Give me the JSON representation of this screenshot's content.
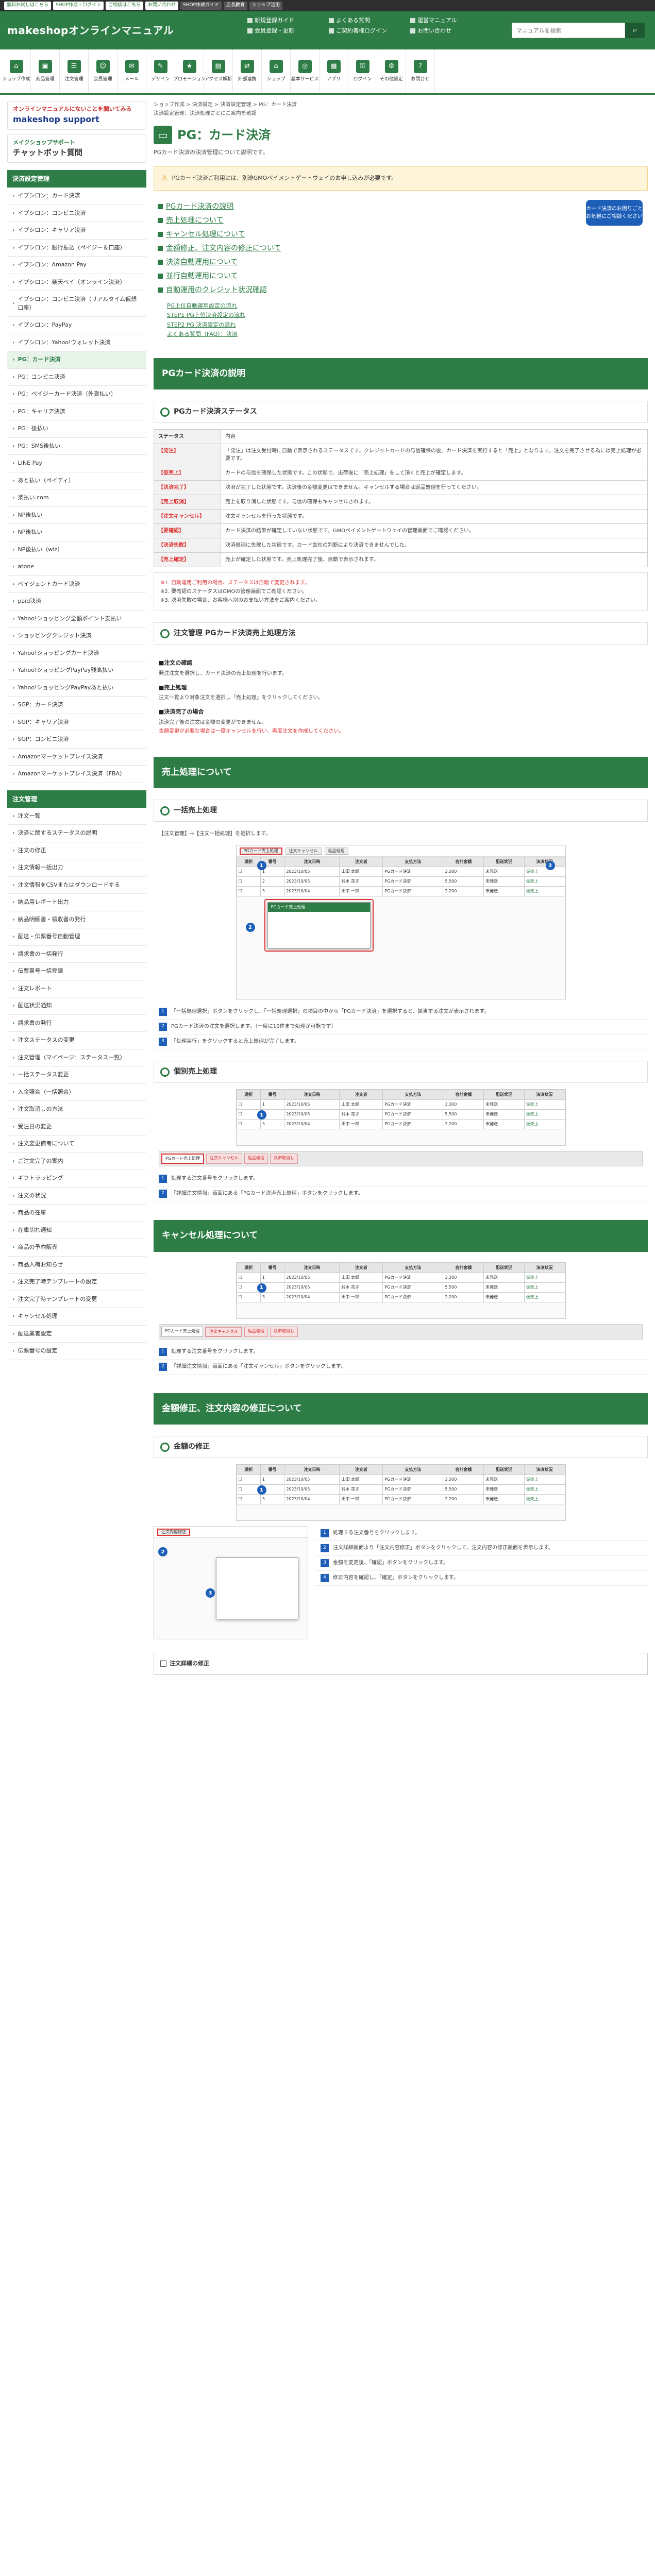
{
  "topbar": {
    "buttons": [
      "無料お試しはこちら",
      "SHOP作成・ログイン",
      "ご相談はこちら",
      "お問い合わせ",
      "SHOP作成ガイド",
      "店長教育",
      "ショップ活用"
    ]
  },
  "header": {
    "logo": "makeshopオンラインマニュアル",
    "links": [
      "新規登録ガイド",
      "よくある質問",
      "運営マニュアル",
      "会員登録・更新",
      "ご契約者様ログイン",
      "お問い合わせ"
    ],
    "search_placeholder": "マニュアルを検索"
  },
  "nav": [
    {
      "label": "ショップ作成",
      "icon": "shop-icon",
      "glyph": "⌂"
    },
    {
      "label": "商品管理",
      "icon": "box-icon",
      "glyph": "▣"
    },
    {
      "label": "注文管理",
      "icon": "order-icon",
      "glyph": "☰"
    },
    {
      "label": "会員管理",
      "icon": "user-icon",
      "glyph": "☺"
    },
    {
      "label": "メール",
      "icon": "mail-icon",
      "glyph": "✉"
    },
    {
      "label": "デザイン",
      "icon": "design-icon",
      "glyph": "✎"
    },
    {
      "label": "プロモーション",
      "icon": "promo-icon",
      "glyph": "★"
    },
    {
      "label": "アクセス解析",
      "icon": "chart-icon",
      "glyph": "▤"
    },
    {
      "label": "外部連携",
      "icon": "link-icon",
      "glyph": "⇄"
    },
    {
      "label": "ショップ",
      "icon": "store-icon",
      "glyph": "⌂"
    },
    {
      "label": "基本サービス",
      "icon": "service-icon",
      "glyph": "◎"
    },
    {
      "label": "アプリ",
      "icon": "app-icon",
      "glyph": "▦"
    },
    {
      "label": "ログイン",
      "icon": "login-icon",
      "glyph": "⚿"
    },
    {
      "label": "その他設定",
      "icon": "settings-icon",
      "glyph": "⚙"
    },
    {
      "label": "お問合せ",
      "icon": "contact-icon",
      "glyph": "?"
    }
  ],
  "sidebar": {
    "banner1": {
      "top": "オンラインマニュアルにないことを聞いてみる",
      "brand": "makeshop support"
    },
    "banner2": {
      "top": "メイクショップサポート",
      "brand": "チャットボット質問"
    },
    "section1": {
      "title": "決済設定管理",
      "items": [
        "イプシロン：カード決済",
        "イプシロン：コンビニ決済",
        "イプシロン：キャリア決済",
        "イプシロン：銀行振込（ペイジー＆口座）",
        "イプシロン：Amazon Pay",
        "イプシロン：楽天ペイ（オンライン決済）",
        "イプシロン：コンビニ決済（リアルタイム仮想口座）",
        "イプシロン：PayPay",
        "イプシロン：Yahoo!ウォレット決済",
        "PG：カード決済",
        "PG：コンビニ決済",
        "PG：ペイジーカード決済（外貨払い）",
        "PG：キャリア決済",
        "PG：後払い",
        "PG：SMS後払い",
        "LINE Pay",
        "あと払い（ペイディ）",
        "楽払い.com",
        "NP後払い",
        "NP後払い",
        "NP後払い（wiz）",
        "atone",
        "ペイジェントカード決済",
        "paid決済",
        "Yahoo!ショッピング全額ポイント支払い",
        "ショッピングクレジット決済",
        "Yahoo!ショッピングカード決済",
        "Yahoo!ショッピングPayPay残高払い",
        "Yahoo!ショッピングPayPayあと払い",
        "SGP：カード決済",
        "SGP：キャリア決済",
        "SGP：コンビニ決済",
        "Amazonマーケットプレイス決済",
        "Amazonマーケットプレイス決済（FBA）"
      ],
      "active_index": 9
    },
    "section2": {
      "title": "注文管理",
      "items": [
        "注文一覧",
        "決済に関するステータスの説明",
        "注文の修正",
        "注文情報一括出力",
        "注文情報をCSVまたはダウンロードする",
        "納品用レポート出力",
        "納品明細書・領収書の発行",
        "配送・伝票番号自動管理",
        "請求書の一括発行",
        "伝票番号一括登録",
        "注文レポート",
        "配送状況通知",
        "請求書の発行",
        "注文ステータスの変更",
        "注文管理（マイページ：ステータス一覧）",
        "一括ステータス変更",
        "入金照合（一括照合）",
        "注文取消しの方法",
        "受注日の変更",
        "注文変更備考について",
        "ご注文完了の案内",
        "ギフトラッピング",
        "注文の状況",
        "商品の在庫",
        "在庫切れ通知",
        "商品の予約販売",
        "商品入荷お知らせ",
        "注文完了時テンプレートの設定",
        "注文完了時テンプレートの変更",
        "キャンセル処理",
        "配送業者設定",
        "伝票番号の設定"
      ]
    }
  },
  "main": {
    "crumb1": "ショップ作成 > 決済設定 > 決済設定管理 > PG：カード決済",
    "crumb2": "決済設定管理：決済処理ごとにご案内を確認",
    "title": "PG：カード決済",
    "lead": "PGカード決済の決済管理について説明です。",
    "notice": "PGカード決済ご利用には、別途GMOペイメントゲートウェイのお申し込みが必要です。",
    "toc": [
      "PGカード決済の説明",
      "売上処理について",
      "キャンセル処理について",
      "金額修正、注文内容の修正について",
      "決済自動運用について",
      "並行自動運用について",
      "自動運用のクレジット状況確認"
    ],
    "toc_sub": [
      "PG上位自動運用設定の流れ",
      "STEP1 PG上位決済設定の流れ",
      "STEP2 PG 決済設定の流れ",
      "よくある質問（FAQ）：決済"
    ],
    "ad": "カード決済のお困りごと　お気軽にご相談ください",
    "section_pg": "PGカード決済の説明",
    "sub_status": "PGカード決済ステータス",
    "status_rows": [
      {
        "label": "ステータス",
        "desc": "内容"
      },
      {
        "label": "【発注】",
        "desc": "「発注」は注文受付時に自動で表示されるステータスです。クレジットカードの与信確保の後、カード決済を実行すると「売上」となります。注文を完了させる為には売上処理が必要です。"
      },
      {
        "label": "【仮売上】",
        "desc": "カードの与信を確保した状態です。この状態で、出荷後に「売上処理」をして頂くと売上が確定します。"
      },
      {
        "label": "【決済完了】",
        "desc": "決済が完了した状態です。決済後の金額変更はできません。キャンセルする場合は返品処理を行ってください。"
      },
      {
        "label": "【売上取消】",
        "desc": "売上を取り消した状態です。与信の確保もキャンセルされます。"
      },
      {
        "label": "【注文キャンセル】",
        "desc": "注文キャンセルを行った状態です。"
      },
      {
        "label": "【要確認】",
        "desc": "カード決済の結果が確定していない状態です。GMOペイメントゲートウェイの管理画面でご確認ください。"
      },
      {
        "label": "【決済失敗】",
        "desc": "決済処理に失敗した状態です。カード会社の判断により決済できませんでした。"
      },
      {
        "label": "【売上確定】",
        "desc": "売上が確定した状態です。売上処理完了後、自動で表示されます。"
      }
    ],
    "status_note": [
      "※1. 自動運用ご利用の場合、ステータスは自動で変更されます。",
      "※2. 要確認のステータスはGMOの管理画面でご確認ください。",
      "※3. 決済失敗の場合、お客様へ別のお支払い方法をご案内ください。"
    ],
    "sub_cancel": "注文管理 PGカード決済売上処理方法",
    "cancel_body": {
      "h1": "■注文の確認",
      "p1": "発注注文を選択し、カード決済の売上処理を行います。",
      "h2": "■売上処理",
      "p2": "注文一覧より対象注文を選択し「売上処理」をクリックしてください。",
      "h3": "■決済完了の場合",
      "p3": "決済完了後の注文は金額の変更ができません。",
      "red": "金額変更が必要な場合は一度キャンセルを行い、再度注文を作成してください。"
    },
    "section_sales": "売上処理について",
    "sub_bulk": "一括売上処理",
    "bulk_caption": "【注文管理】→【注文一括処理】を選択します。",
    "bulk_steps": [
      "「一括処理選択」ボタンをクリックし、「一括処理選択」の項目の中から「PGカード決済」を選択すると、該当する注文が表示されます。",
      "PGカード決済の注文を選択します。（一度に10件まで処理が可能です）",
      "「処理実行」をクリックすると売上処理が完了します。"
    ],
    "sub_single": "個別売上処理",
    "single_steps": [
      "処理する注文番号をクリックします。",
      "「詳細注文情報」画面にある「PGカード決済売上処理」ボタンをクリックします。"
    ],
    "section_cancel": "キャンセル処理について",
    "cancel_steps": [
      "処理する注文番号をクリックします。",
      "「詳細注文情報」画面にある「注文キャンセル」ボタンをクリックします。"
    ],
    "section_modify": "金額修正、注文内容の修正について",
    "sub_amount": "金額の修正",
    "amount_steps": [
      "処理する注文番号をクリックします。",
      "注文詳細画面より「注文内容修正」ボタンをクリックして、注文内容の修正画面を表示します。",
      "金額を変更後、「確認」ボタンをクリックします。",
      "修正内容を確認し、「確定」ボタンをクリックします。"
    ],
    "shot_buttons": [
      "PGカード売上処理",
      "注文キャンセル",
      "返品処理",
      "決済取消し",
      "注文内容修正"
    ],
    "table_headers": [
      "選択",
      "番号",
      "注文日時",
      "注文者",
      "支払方法",
      "合計金額",
      "配送状況",
      "決済状況"
    ],
    "table_rows": [
      [
        "",
        "1",
        "2023/10/05",
        "山田 太郎",
        "PGカード決済",
        "3,300",
        "未発送",
        "仮売上"
      ],
      [
        "",
        "2",
        "2023/10/05",
        "鈴木 花子",
        "PGカード決済",
        "5,500",
        "未発送",
        "仮売上"
      ],
      [
        "",
        "3",
        "2023/10/04",
        "田中 一郎",
        "PGカード決済",
        "2,200",
        "未発送",
        "仮売上"
      ]
    ],
    "bottom": "注文詳細の修正"
  }
}
